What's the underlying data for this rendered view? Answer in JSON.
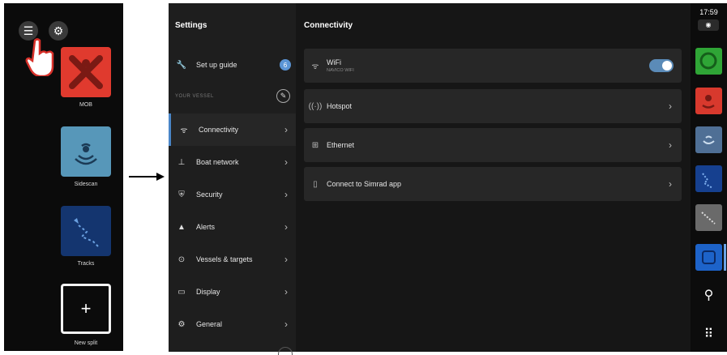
{
  "left_panel": {
    "apps": [
      {
        "label": "MOB"
      },
      {
        "label": "Sidescan"
      },
      {
        "label": "Tracks"
      },
      {
        "label": "New split"
      }
    ],
    "new_split_symbol": "+"
  },
  "settings": {
    "title": "Settings",
    "setup_guide": {
      "label": "Set up guide",
      "badge": "6"
    },
    "section_label": "YOUR VESSEL",
    "items": [
      {
        "label": "Connectivity",
        "icon": "wifi-icon"
      },
      {
        "label": "Boat network",
        "icon": "network-icon"
      },
      {
        "label": "Security",
        "icon": "shield-icon"
      },
      {
        "label": "Alerts",
        "icon": "alert-icon"
      },
      {
        "label": "Vessels & targets",
        "icon": "target-icon"
      },
      {
        "label": "Display",
        "icon": "display-icon"
      },
      {
        "label": "General",
        "icon": "gear-icon"
      }
    ]
  },
  "connectivity": {
    "title": "Connectivity",
    "wifi": {
      "label": "WiFi",
      "network": "NAVICO WIFI",
      "enabled": true
    },
    "rows": [
      {
        "label": "Hotspot"
      },
      {
        "label": "Ethernet"
      },
      {
        "label": "Connect to Simrad app"
      }
    ]
  },
  "status_bar": {
    "time": "17:59"
  },
  "colors": {
    "accent": "#5b8bb8",
    "mob_red": "#e03a2e",
    "sidescan_blue": "#5797b9",
    "tracks_navy": "#14356f"
  }
}
